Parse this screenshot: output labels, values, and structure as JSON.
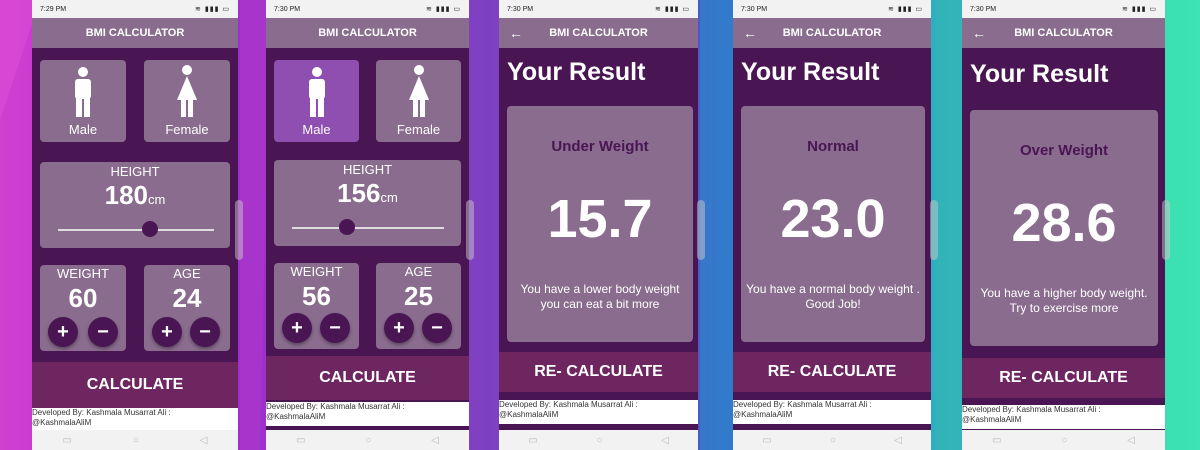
{
  "screens": [
    {
      "time": "7:29 PM",
      "title": "BMI CALCULATOR",
      "male_label": "Male",
      "female_label": "Female",
      "height_label": "HEIGHT",
      "height_value": "180",
      "height_unit": "cm",
      "height_slider_fraction": 0.59,
      "weight_label": "WEIGHT",
      "weight_value": "60",
      "age_label": "AGE",
      "age_value": "24",
      "plus": "+",
      "minus": "−",
      "calculate": "CALCULATE",
      "developer": "Developed By: Kashmala Musarrat Ali :",
      "handle": "@KashmalaAliM"
    },
    {
      "time": "7:30 PM",
      "title": "BMI CALCULATOR",
      "male_label": "Male",
      "female_label": "Female",
      "height_label": "HEIGHT",
      "height_value": "156",
      "height_unit": "cm",
      "height_slider_fraction": 0.36,
      "weight_label": "WEIGHT",
      "weight_value": "56",
      "age_label": "AGE",
      "age_value": "25",
      "plus": "+",
      "minus": "−",
      "calculate": "CALCULATE",
      "developer": "Developed By: Kashmala Musarrat Ali :",
      "handle": "@KashmalaAliM"
    }
  ],
  "results": [
    {
      "time": "7:30 PM",
      "title": "BMI CALCULATOR",
      "back": "←",
      "your_result": "Your Result",
      "status": "Under Weight",
      "value": "15.7",
      "message": "You have a lower body weight you can eat a bit more",
      "recalculate": "RE- CALCULATE",
      "developer": "Developed By: Kashmala Musarrat Ali :",
      "handle": "@KashmalaAliM"
    },
    {
      "time": "7:30 PM",
      "title": "BMI CALCULATOR",
      "back": "←",
      "your_result": "Your Result",
      "status": "Normal",
      "value": "23.0",
      "message": "You have a normal body weight . Good Job!",
      "recalculate": "RE- CALCULATE",
      "developer": "Developed By: Kashmala Musarrat Ali :",
      "handle": "@KashmalaAliM"
    },
    {
      "time": "7:30 PM",
      "title": "BMI CALCULATOR",
      "back": "←",
      "your_result": "Your Result",
      "status": "Over Weight",
      "value": "28.6",
      "message": "You have a higher body weight. Try to exercise more",
      "recalculate": "RE- CALCULATE",
      "developer": "Developed By: Kashmala Musarrat Ali :",
      "handle": "@KashmalaAliM"
    }
  ],
  "icons": {
    "wifi": "wifi-icon",
    "signal": "signal-icon",
    "battery": "battery-icon",
    "back": "back-arrow-icon",
    "male": "male-icon",
    "female": "female-icon"
  },
  "colors": {
    "primary_dark": "#4a1553",
    "card": "#8a6c8e",
    "selected_card": "#8e4fb0",
    "button": "#6e2661",
    "status_text": "#4a1553"
  }
}
